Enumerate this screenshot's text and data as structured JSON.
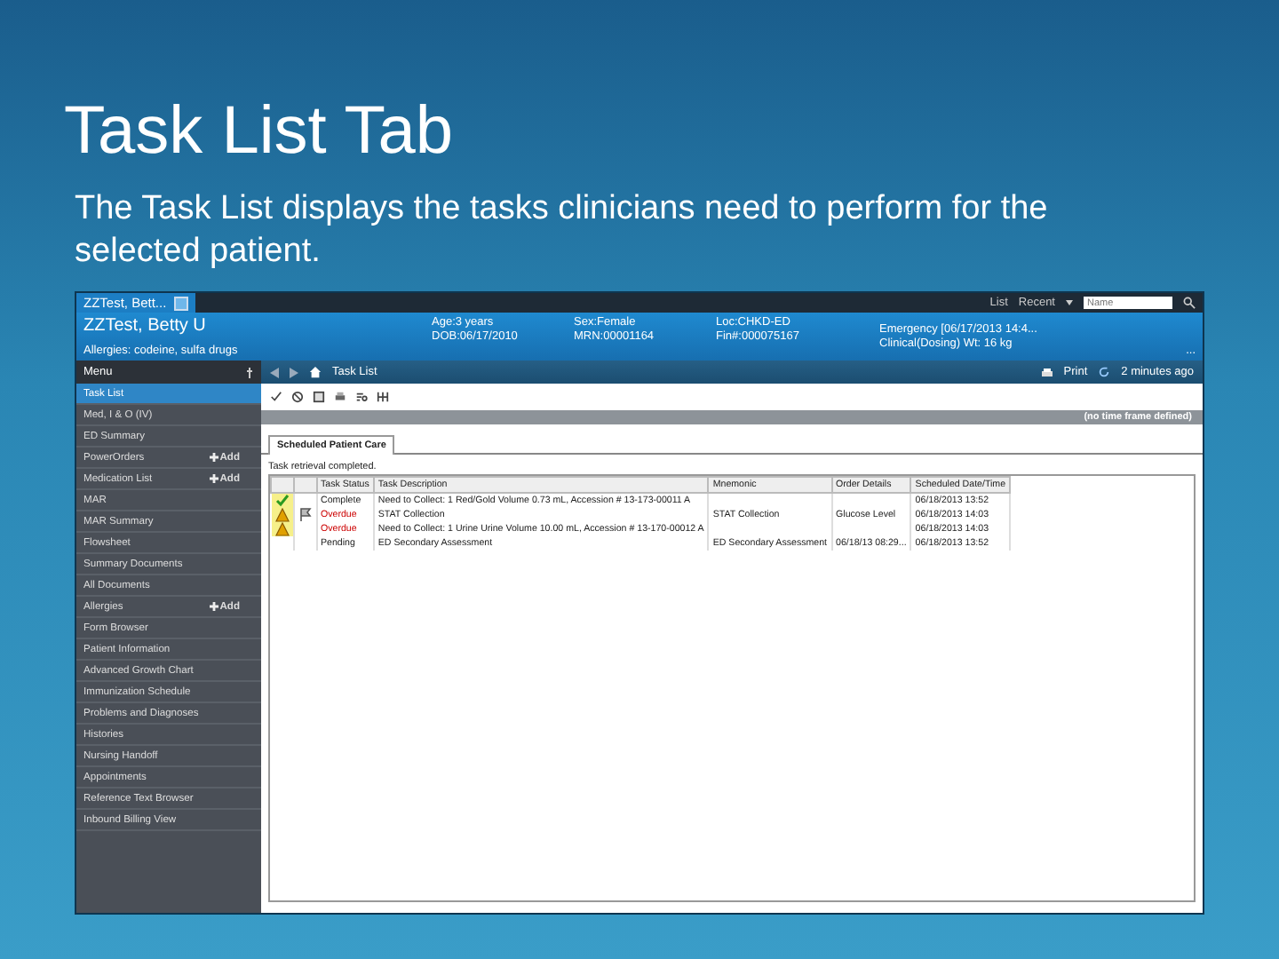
{
  "slide": {
    "title": "Task List Tab",
    "body": "The Task List displays the tasks clinicians need to perform for the selected patient."
  },
  "app": {
    "top_bar": {
      "patient_tab": "ZZTest, Bett...",
      "list_button": "List",
      "recent_button": "Recent",
      "search": {
        "placeholder": "Name"
      }
    },
    "banner": {
      "name": "ZZTest, Betty U",
      "allergies": "Allergies: codeine, sulfa drugs",
      "columns": [
        {
          "line_1": "Age:3 years",
          "line_2": "DOB:06/17/2010"
        },
        {
          "line_1": "Sex:Female",
          "line_2": "MRN:00001164"
        },
        {
          "line_1": "Loc:CHKD-ED",
          "line_2": "Fin#:000075167"
        },
        {
          "line_1": "Emergency [06/17/2013 14:4...",
          "line_2": "Clinical(Dosing) Wt: 16 kg"
        }
      ],
      "more": "..."
    },
    "menu": {
      "header": "Menu",
      "items": [
        {
          "label": "Task List",
          "selected": true
        },
        {
          "label": "Med, I & O (IV)",
          "selected": false
        },
        {
          "label": "ED Summary",
          "selected": false
        },
        {
          "label": "PowerOrders",
          "selected": false,
          "add": "Add"
        },
        {
          "label": "Medication List",
          "selected": false,
          "add": "Add"
        },
        {
          "label": "MAR",
          "selected": false
        },
        {
          "label": "MAR Summary",
          "selected": false
        },
        {
          "label": "Flowsheet",
          "selected": false
        },
        {
          "label": "Summary Documents",
          "selected": false
        },
        {
          "label": "All Documents",
          "selected": false
        },
        {
          "label": "Allergies",
          "selected": false,
          "add": "Add"
        },
        {
          "label": "Form Browser",
          "selected": false
        },
        {
          "label": "Patient Information",
          "selected": false
        },
        {
          "label": "Advanced Growth Chart",
          "selected": false
        },
        {
          "label": "Immunization Schedule",
          "selected": false
        },
        {
          "label": "Problems and Diagnoses",
          "selected": false
        },
        {
          "label": "Histories",
          "selected": false
        },
        {
          "label": "Nursing Handoff",
          "selected": false
        },
        {
          "label": "Appointments",
          "selected": false
        },
        {
          "label": "Reference Text Browser",
          "selected": false
        },
        {
          "label": "Inbound Billing View",
          "selected": false
        }
      ]
    },
    "page_toolbar": {
      "title": "Task List",
      "print": "Print",
      "refreshed": "2 minutes ago"
    },
    "time_frame": "(no time frame defined)",
    "tabs": [
      {
        "label": "Scheduled Patient Care",
        "selected": true
      }
    ],
    "status_message": "Task retrieval completed.",
    "table": {
      "columns": [
        "",
        "",
        "Task Status",
        "Task Description",
        "Mnemonic",
        "Order Details",
        "Scheduled Date/Time"
      ],
      "rows": [
        {
          "kind": "complete",
          "flag": false,
          "cells": [
            "",
            "",
            "Complete",
            "Need to Collect: 1 Red/Gold Volume 0.73 mL, Accession # 13-173-00011 A",
            "",
            "",
            "06/18/2013 13:52"
          ]
        },
        {
          "kind": "overdue",
          "flag": true,
          "cells": [
            "",
            "",
            "Overdue",
            "STAT Collection",
            "STAT Collection",
            "Glucose Level",
            "06/18/2013 14:03"
          ]
        },
        {
          "kind": "overdue",
          "flag": false,
          "cells": [
            "",
            "",
            "Overdue",
            "Need to Collect: 1 Urine Urine Volume 10.00 mL, Accession # 13-170-00012 A",
            "",
            "",
            "06/18/2013 14:03"
          ]
        },
        {
          "kind": "pending",
          "flag": false,
          "cells": [
            "",
            "",
            "Pending",
            "ED Secondary Assessment",
            "ED Secondary Assessment",
            "06/18/13 08:29...",
            "06/18/2013 13:52"
          ]
        }
      ]
    }
  }
}
